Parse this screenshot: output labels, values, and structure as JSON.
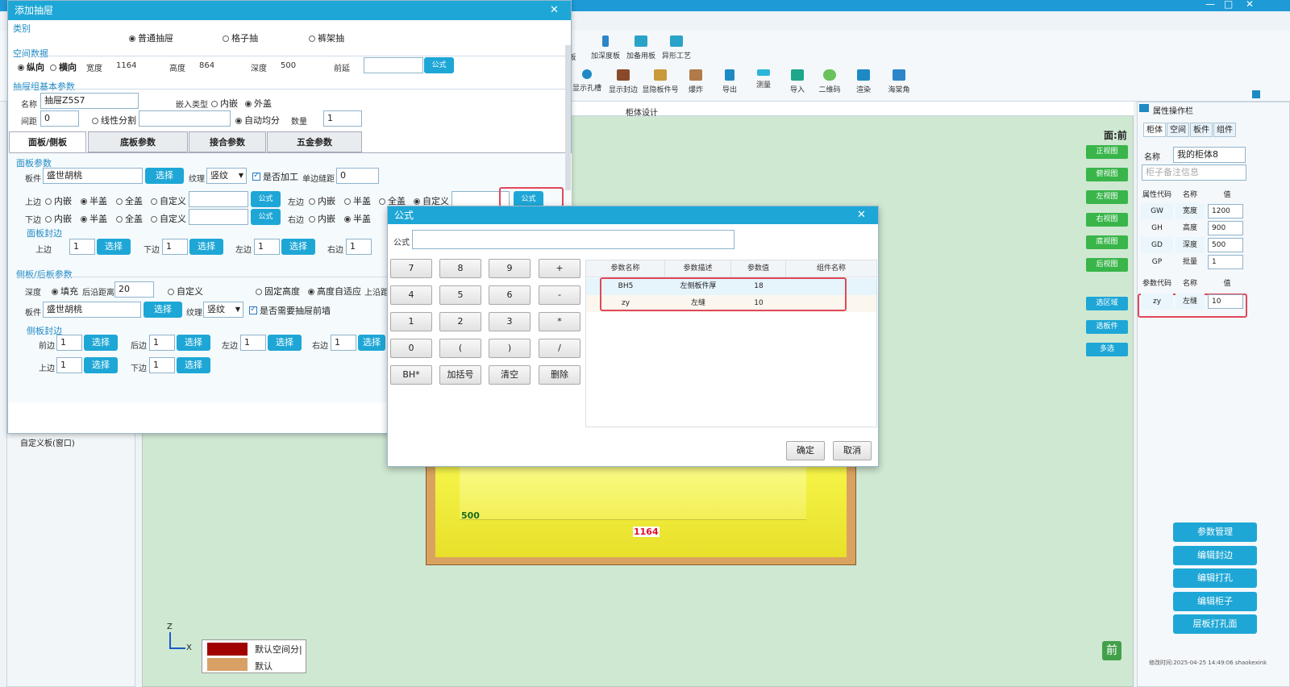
{
  "app": {
    "title": "添加抽屉",
    "minimize": "—",
    "maximize": "□",
    "close": "✕"
  },
  "toolbar": {
    "top_row": [
      "板",
      "加深度板",
      "加备用板",
      "异形工艺"
    ],
    "items": [
      "显示孔槽",
      "显示封边",
      "显隐板件号",
      "爆炸",
      "导出",
      "测量",
      "导入",
      "二维码",
      "渲染",
      "海棠角"
    ]
  },
  "leftpanel": {
    "item": "自定义板(窗口)"
  },
  "canvas": {
    "header": "柜体设计",
    "face_label": "面:前",
    "view_buttons": [
      "正视图",
      "俯视图",
      "左视图",
      "右视图",
      "底视图",
      "后视图"
    ],
    "select_buttons": [
      "选区域",
      "选板件",
      "多选"
    ],
    "dim_depth": "500",
    "dim_width": "1164",
    "axis": {
      "z": "Z",
      "x": "X"
    },
    "legend": [
      {
        "label": "默认空间分|",
        "color": "#a00000"
      },
      {
        "label": "默认",
        "color": "#d9a066"
      }
    ],
    "badge": "前"
  },
  "rightpanel": {
    "title": "属性操作栏",
    "tabs": [
      "柜体",
      "空间",
      "板件",
      "组件"
    ],
    "name_label": "名称",
    "name_value": "我的柜体8",
    "note_placeholder": "柜子备注信息",
    "attr_headers": [
      "属性代码",
      "名称",
      "值"
    ],
    "attrs": [
      {
        "code": "GW",
        "name": "宽度",
        "value": "1200"
      },
      {
        "code": "GH",
        "name": "高度",
        "value": "900"
      },
      {
        "code": "GD",
        "name": "深度",
        "value": "500"
      },
      {
        "code": "GP",
        "name": "批量",
        "value": "1"
      }
    ],
    "param_headers": [
      "参数代码",
      "名称",
      "值"
    ],
    "params": [
      {
        "code": "zy",
        "name": "左缝",
        "value": "10"
      }
    ],
    "buttons": [
      "参数管理",
      "编辑封边",
      "编辑打孔",
      "编辑柜子",
      "层板打孔面"
    ],
    "footer": "修改时间:2025-04-25 14:49:06 shaokexink"
  },
  "drawer_dialog": {
    "title": "添加抽屉",
    "category": {
      "label": "类别",
      "options": [
        "普通抽屉",
        "格子抽",
        "裤架抽"
      ]
    },
    "space": {
      "label": "空间数据",
      "dir_options": [
        "纵向",
        "横向"
      ],
      "width_label": "宽度",
      "width": "1164",
      "height_label": "高度",
      "height": "864",
      "depth_label": "深度",
      "depth": "500",
      "front_label": "前延",
      "formula_btn": "公式"
    },
    "basic": {
      "label": "抽屉组基本参数",
      "name_label": "名称",
      "name_value": "抽屉Z5S7",
      "embed_label": "嵌入类型",
      "embed_options": [
        "内嵌",
        "外盖"
      ],
      "gap_label": "间距",
      "gap_value": "0",
      "linear_label": "线性分割",
      "auto_label": "自动均分",
      "count_label": "数量",
      "count_value": "1"
    },
    "tabs": [
      "面板/侧板",
      "底板参数",
      "接合参数",
      "五金参数"
    ],
    "panel": {
      "label": "面板参数",
      "board_label": "板件",
      "board_value": "盛世胡桃",
      "select_btn": "选择",
      "grain_label": "纹理",
      "grain_value": "竖纹",
      "process_label": "是否加工",
      "edge_gap_label": "单边缝距",
      "edge_gap_value": "0",
      "top_label": "上边",
      "bottom_label": "下边",
      "left_label": "左边",
      "right_label": "右边",
      "cover_options": [
        "内嵌",
        "半盖",
        "全盖",
        "自定义"
      ],
      "formula_btn": "公式",
      "edge_band_label": "面板封边",
      "band": [
        {
          "label": "上边",
          "value": "1"
        },
        {
          "label": "下边",
          "value": "1"
        },
        {
          "label": "左边",
          "value": "1"
        },
        {
          "label": "右边",
          "value": "1"
        }
      ]
    },
    "side": {
      "label": "侧板/后板参数",
      "depth_label": "深度",
      "fill_label": "填充",
      "back_dist_label": "后沿距离",
      "back_dist_value": "20",
      "custom_label": "自定义",
      "fixed_h_label": "固定高度",
      "auto_h_label": "高度自适应",
      "up_dist_label": "上沿距",
      "board_label": "板件",
      "board_value": "盛世胡桃",
      "grain_label": "纹理",
      "grain_value": "竖纹",
      "need_front_label": "是否需要抽屉前墙",
      "edge_band_label": "侧板封边",
      "band": [
        {
          "label": "前边",
          "value": "1"
        },
        {
          "label": "后边",
          "value": "1"
        },
        {
          "label": "左边",
          "value": "1"
        },
        {
          "label": "右边",
          "value": "1"
        },
        {
          "label": "上边",
          "value": "1"
        },
        {
          "label": "下边",
          "value": "1"
        }
      ]
    }
  },
  "formula_dialog": {
    "title": "公式",
    "input_label": "公式",
    "keys": [
      "7",
      "8",
      "9",
      "+",
      "4",
      "5",
      "6",
      "-",
      "1",
      "2",
      "3",
      "*",
      "0",
      "(",
      ")",
      "/",
      "BH*",
      "加括号",
      "清空",
      "删除"
    ],
    "headers": [
      "参数名称",
      "参数描述",
      "参数值",
      "组件名称"
    ],
    "rows": [
      {
        "name": "BH5",
        "desc": "左侧板件厚",
        "value": "18",
        "comp": ""
      },
      {
        "name": "zy",
        "desc": "左缝",
        "value": "10",
        "comp": ""
      }
    ],
    "ok": "确定",
    "cancel": "取消"
  }
}
